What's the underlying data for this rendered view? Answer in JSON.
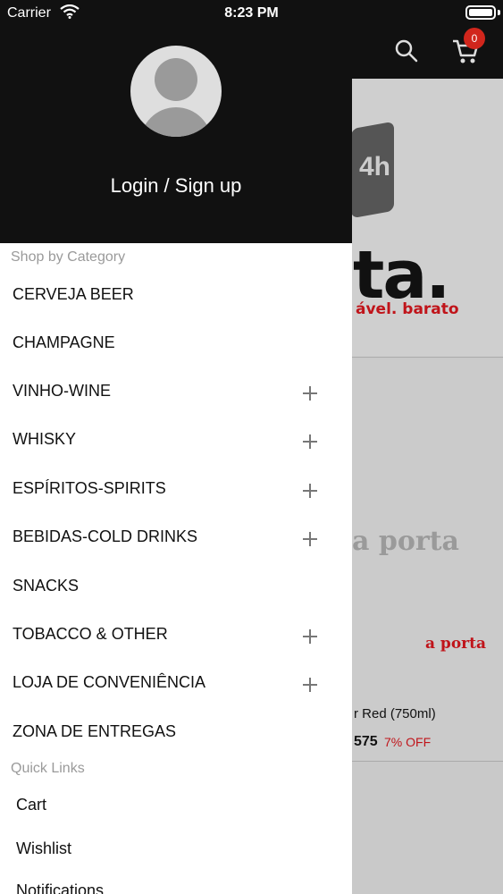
{
  "status_bar": {
    "carrier": "Carrier",
    "time": "8:23 PM"
  },
  "background": {
    "cart_count": "0",
    "banner_text": "ta.",
    "banner_hours": "4h",
    "banner_sub": "ável. barato",
    "watermark": "a porta",
    "small_logo": "a porta",
    "product_name": "r Red (750ml)",
    "price": "575",
    "discount": "7% OFF"
  },
  "drawer": {
    "login_label": "Login / Sign up",
    "shop_by_category_label": "Shop by Category",
    "categories": [
      {
        "label": "CERVEJA BEER",
        "expandable": false
      },
      {
        "label": "CHAMPAGNE",
        "expandable": false
      },
      {
        "label": "VINHO-WINE",
        "expandable": true
      },
      {
        "label": "WHISKY",
        "expandable": true
      },
      {
        "label": "ESPÍRITOS-SPIRITS",
        "expandable": true
      },
      {
        "label": "BEBIDAS-COLD DRINKS",
        "expandable": true
      },
      {
        "label": "SNACKS",
        "expandable": false
      },
      {
        "label": "TOBACCO & OTHER",
        "expandable": true
      },
      {
        "label": "LOJA DE CONVENIÊNCIA",
        "expandable": true
      },
      {
        "label": "ZONA DE ENTREGAS",
        "expandable": false
      }
    ],
    "quick_links_label": "Quick Links",
    "quick_links": [
      "Cart",
      "Wishlist",
      "Notifications"
    ]
  },
  "colors": {
    "header_bg": "#111111",
    "accent_red": "#d1261c",
    "section_gray": "#9a9a9a"
  }
}
